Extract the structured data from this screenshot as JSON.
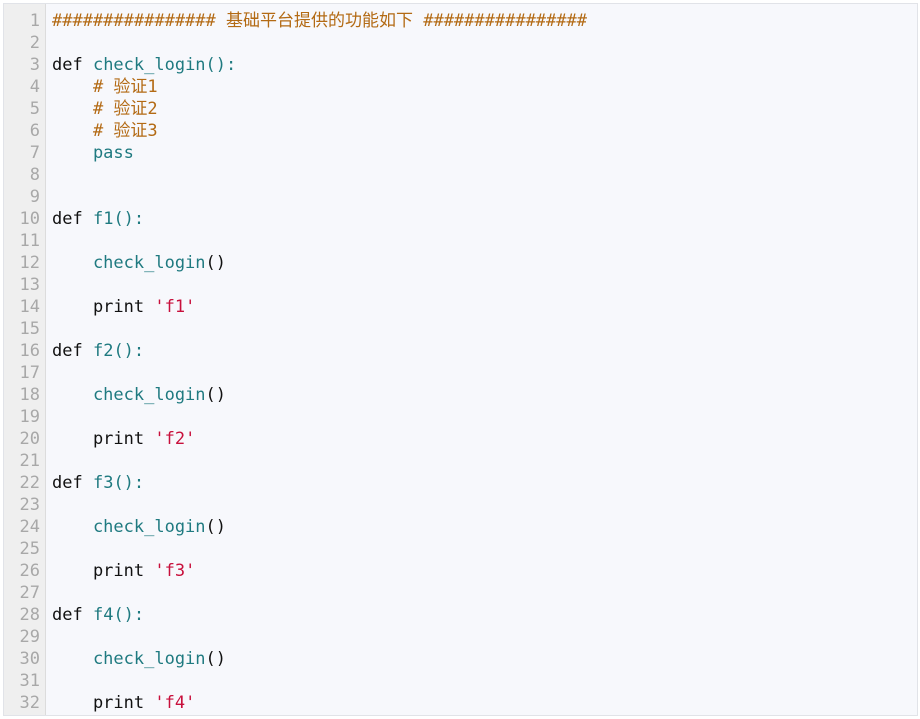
{
  "editor": {
    "line_numbers": [
      "1",
      "2",
      "3",
      "4",
      "5",
      "6",
      "7",
      "8",
      "9",
      "10",
      "11",
      "12",
      "13",
      "14",
      "15",
      "16",
      "17",
      "18",
      "19",
      "20",
      "21",
      "22",
      "23",
      "24",
      "25",
      "26",
      "27",
      "28",
      "29",
      "30",
      "31",
      "32"
    ],
    "lines": [
      [
        {
          "t": "################ 基础平台提供的功能如下 ################",
          "c": "cm"
        }
      ],
      [],
      [
        {
          "t": "def ",
          "c": "kw"
        },
        {
          "t": "check_login",
          "c": "fn"
        },
        {
          "t": "():",
          "c": "pn"
        }
      ],
      [
        {
          "t": "    # 验证1",
          "c": "cm"
        }
      ],
      [
        {
          "t": "    # 验证2",
          "c": "cm"
        }
      ],
      [
        {
          "t": "    # 验证3",
          "c": "cm"
        }
      ],
      [
        {
          "t": "    pass",
          "c": "ps"
        }
      ],
      [],
      [],
      [
        {
          "t": "def ",
          "c": "kw"
        },
        {
          "t": "f1",
          "c": "fn"
        },
        {
          "t": "():",
          "c": "pn"
        }
      ],
      [],
      [
        {
          "t": "    check_login",
          "c": "fn"
        },
        {
          "t": "()",
          "c": "kw"
        }
      ],
      [],
      [
        {
          "t": "    print ",
          "c": "kw"
        },
        {
          "t": "'f1'",
          "c": "st"
        }
      ],
      [],
      [
        {
          "t": "def ",
          "c": "kw"
        },
        {
          "t": "f2",
          "c": "fn"
        },
        {
          "t": "():",
          "c": "pn"
        }
      ],
      [],
      [
        {
          "t": "    check_login",
          "c": "fn"
        },
        {
          "t": "()",
          "c": "kw"
        }
      ],
      [],
      [
        {
          "t": "    print ",
          "c": "kw"
        },
        {
          "t": "'f2'",
          "c": "st"
        }
      ],
      [],
      [
        {
          "t": "def ",
          "c": "kw"
        },
        {
          "t": "f3",
          "c": "fn"
        },
        {
          "t": "():",
          "c": "pn"
        }
      ],
      [],
      [
        {
          "t": "    check_login",
          "c": "fn"
        },
        {
          "t": "()",
          "c": "kw"
        }
      ],
      [],
      [
        {
          "t": "    print ",
          "c": "kw"
        },
        {
          "t": "'f3'",
          "c": "st"
        }
      ],
      [],
      [
        {
          "t": "def ",
          "c": "kw"
        },
        {
          "t": "f4",
          "c": "fn"
        },
        {
          "t": "():",
          "c": "pn"
        }
      ],
      [],
      [
        {
          "t": "    check_login",
          "c": "fn"
        },
        {
          "t": "()",
          "c": "kw"
        }
      ],
      [],
      [
        {
          "t": "    print ",
          "c": "kw"
        },
        {
          "t": "'f4'",
          "c": "st"
        }
      ]
    ],
    "colors": {
      "background": "#f7f8fc",
      "gutter": "#efefef",
      "line_number": "#a8a8a8",
      "keyword": "#111111",
      "function": "#1f7a80",
      "comment": "#b36a14",
      "string": "#c8103c"
    }
  }
}
